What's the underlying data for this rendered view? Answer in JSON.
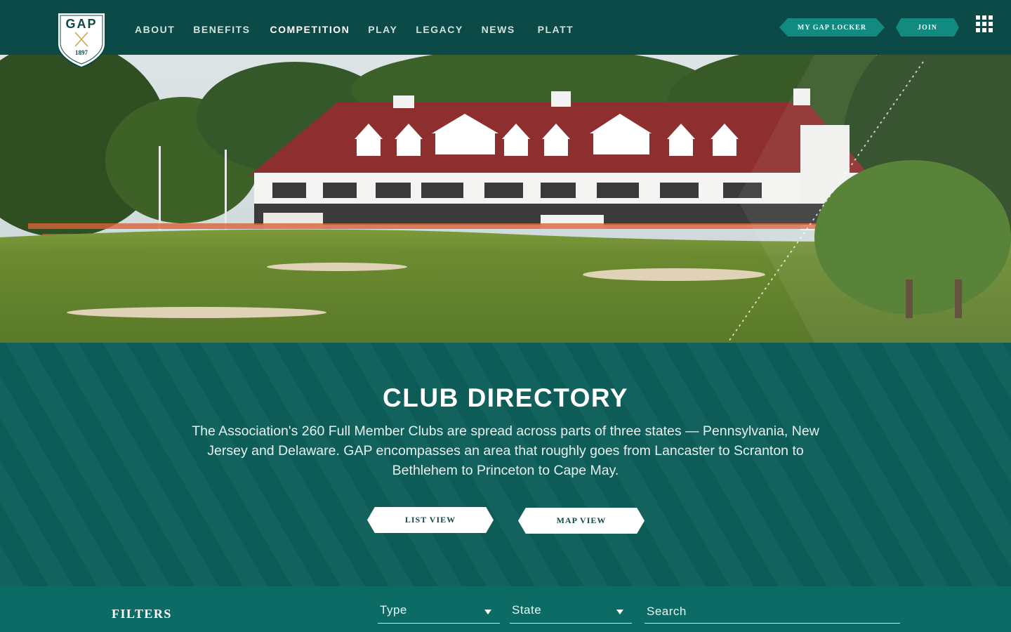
{
  "brand": {
    "name": "GAP",
    "year": "1897"
  },
  "nav": {
    "items": [
      {
        "label": "ABOUT",
        "active": false
      },
      {
        "label": "BENEFITS",
        "active": false
      },
      {
        "label": "COMPETITION",
        "active": true
      },
      {
        "label": "PLAY",
        "active": false
      },
      {
        "label": "LEGACY",
        "active": false
      },
      {
        "label": "NEWS",
        "active": false
      },
      {
        "label": "PLATT",
        "active": false
      }
    ],
    "locker_label": "MY GAP LOCKER",
    "join_label": "JOIN",
    "menu_icon": "grid-menu-icon"
  },
  "hero": {
    "image": "clubhouse-photo"
  },
  "directory": {
    "title": "CLUB DIRECTORY",
    "description": "The Association's 260 Full Member Clubs are spread across parts of three states — Pennsylvania, New Jersey and Delaware. GAP encompasses an area that roughly goes from Lancaster to Scranton to Bethlehem to Princeton to Cape May.",
    "list_view_label": "LIST VIEW",
    "map_view_label": "MAP VIEW"
  },
  "filters": {
    "label": "FILTERS",
    "type_label": "Type",
    "state_label": "State",
    "search_placeholder": "Search"
  },
  "colors": {
    "nav_bg": "#0b4a46",
    "section_bg": "#0d5e59",
    "filters_bg": "#0d6b65",
    "accent": "#128a80"
  }
}
